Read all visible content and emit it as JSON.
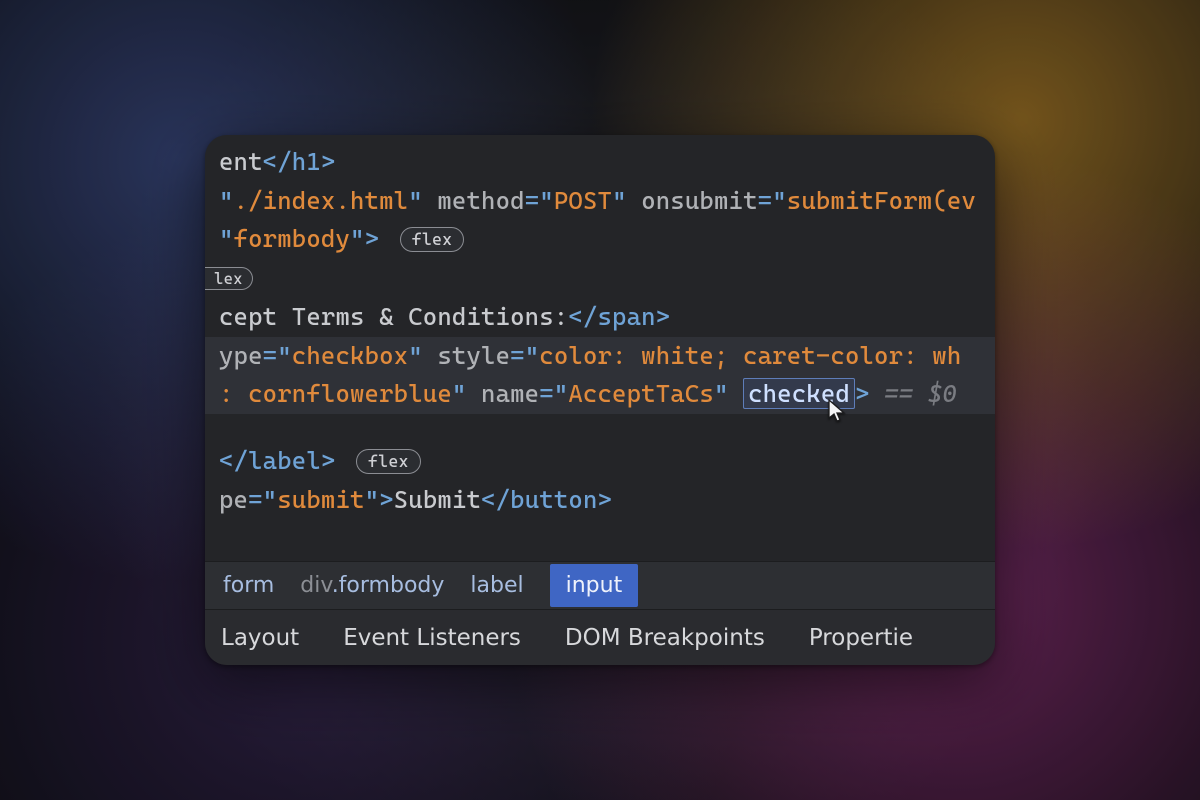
{
  "code": {
    "l1_pre": "ent",
    "l1_close": "</h1>",
    "l2_attr1_val": "./index.html",
    "l2_attr2_name": "method",
    "l2_attr2_val": "POST",
    "l2_attr3_name": "onsubmit",
    "l2_attr3_val": "submitForm(ev",
    "l3_pre_val": "formbody",
    "l3_pill": "flex",
    "l4_pill": "lex",
    "l5_text": "cept Terms & Conditions:",
    "l5_close": "</span>",
    "l6_attr1_name": "ype",
    "l6_attr1_val": "checkbox",
    "l6_attr2_name": "style",
    "l6_attr2_val": "color: white; caret-color: wh",
    "l7_pre_val": ": cornflowerblue",
    "l7_attr2_name": "name",
    "l7_attr2_val": "AcceptTaCs",
    "l7_sel_attr": "checked",
    "l7_gt": ">",
    "l7_ref": " == $0",
    "l8_close": "</label>",
    "l8_pill": "flex",
    "l9_attr_name": "pe",
    "l9_attr_val": "submit",
    "l9_text": "Submit",
    "l9_close": "</button>"
  },
  "breadcrumbs": {
    "b1": "form",
    "b2_pre": "div",
    "b2_cls": ".formbody",
    "b3": "label",
    "b4": "input"
  },
  "tabs": {
    "t1": "Layout",
    "t2": "Event Listeners",
    "t3": "DOM Breakpoints",
    "t4": "Propertie"
  }
}
